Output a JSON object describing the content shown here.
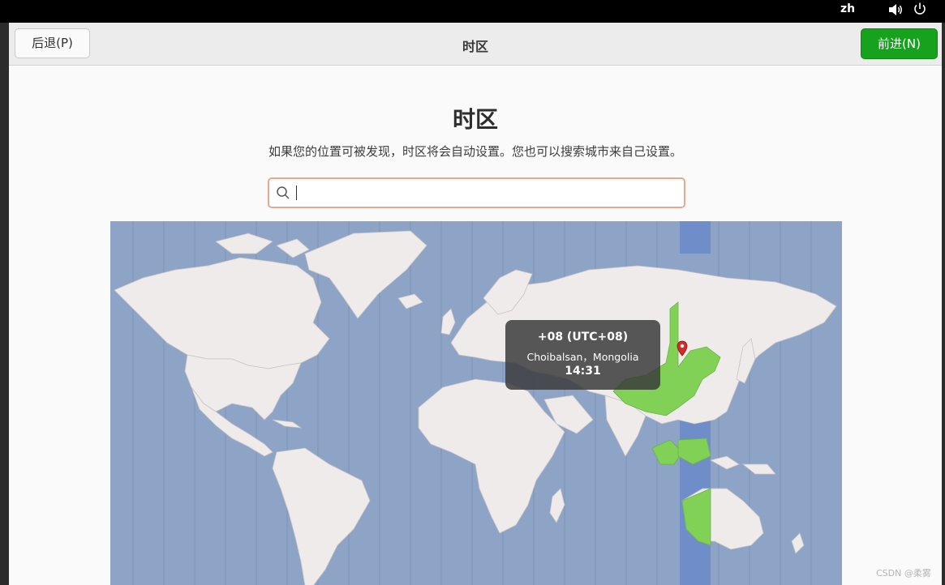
{
  "system_bar": {
    "language": "zh"
  },
  "header": {
    "back_label": "后退(P)",
    "title": "时区",
    "next_label": "前进(N)"
  },
  "page": {
    "heading": "时区",
    "subtitle": "如果您的位置可被发现，时区将会自动设置。您也可以搜索城市来自己设置。"
  },
  "search": {
    "value": "",
    "placeholder": ""
  },
  "tooltip": {
    "timezone": "+08 (UTC+08)",
    "city": "Choibalsan，Mongolia",
    "time": "14:31"
  },
  "watermark": "CSDN @柔雾",
  "colors": {
    "accent_green": "#16a21c",
    "ocean": "#8ea4c6",
    "land": "#efebea",
    "selected_zone": "#82d157",
    "search_border": "#eba68f"
  },
  "icons": {
    "search": "search-icon",
    "volume": "volume-icon",
    "power": "power-icon",
    "pin": "map-pin-icon"
  }
}
